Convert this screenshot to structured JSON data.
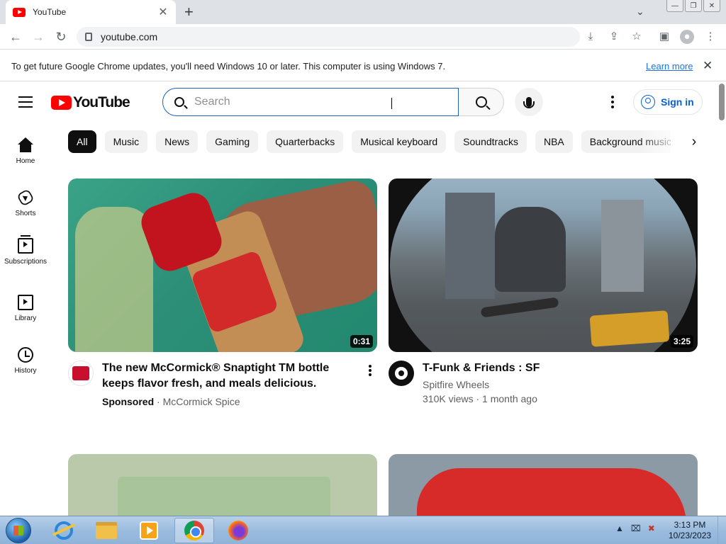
{
  "browser": {
    "tab_title": "YouTube",
    "tab_close": "✕",
    "new_tab": "+",
    "url": "youtube.com",
    "back": "←",
    "forward": "→",
    "reload": "↻",
    "window_buttons": [
      "—",
      "❐",
      "✕"
    ],
    "tab_dropdown": "⌄",
    "toolbar_icons": [
      "download-icon",
      "share-icon",
      "bookmark-star-icon",
      "side-panel-icon",
      "profile-icon",
      "chrome-menu-icon"
    ]
  },
  "infobar": {
    "message": "To get future Google Chrome updates, you'll need Windows 10 or later. This computer is using Windows 7.",
    "learn_more": "Learn more",
    "close": "✕"
  },
  "youtube": {
    "logo_text": "YouTube",
    "search_placeholder": "Search",
    "sign_in": "Sign in",
    "guide": [
      {
        "label": "Home",
        "icon": "home-icon"
      },
      {
        "label": "Shorts",
        "icon": "shorts-icon"
      },
      {
        "label": "Subscriptions",
        "icon": "subscriptions-icon"
      },
      {
        "label": "Library",
        "icon": "library-icon"
      },
      {
        "label": "History",
        "icon": "history-icon"
      }
    ],
    "chips": [
      "All",
      "Music",
      "News",
      "Gaming",
      "Quarterbacks",
      "Musical keyboard",
      "Soundtracks",
      "NBA",
      "Background music"
    ],
    "chips_next": "›",
    "videos": [
      {
        "title": "The new McCormick® Snaptight TM bottle keeps flavor fresh, and meals delicious.",
        "sponsored_label": "Sponsored",
        "separator": "·",
        "channel": "McCormick Spice",
        "duration": "0:31"
      },
      {
        "title": "T-Funk & Friends : SF",
        "channel": "Spitfire Wheels",
        "stats": "310K views · 1 month ago",
        "duration": "3:25"
      }
    ]
  },
  "taskbar": {
    "apps": [
      "internet-explorer-icon",
      "file-explorer-icon",
      "media-player-icon",
      "chrome-icon",
      "firefox-icon"
    ],
    "active_app": "chrome-icon",
    "tray": [
      "▲",
      "⌧",
      "✖"
    ],
    "time": "3:13 PM",
    "date": "10/23/2023"
  }
}
